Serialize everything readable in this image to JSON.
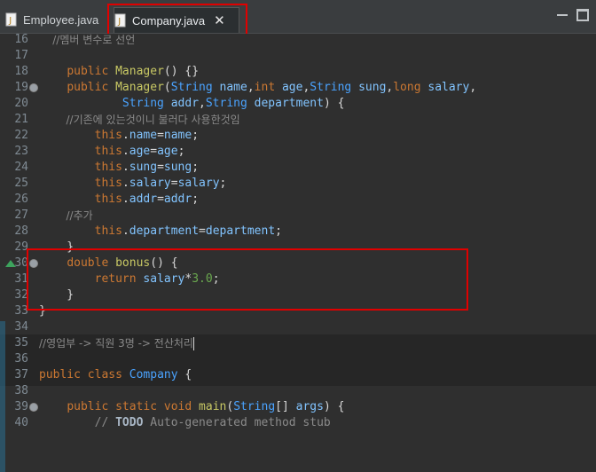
{
  "tabs": [
    {
      "label": "Employee.java",
      "active": false
    },
    {
      "label": "Company.java",
      "active": true
    }
  ],
  "lines": [
    {
      "n": "16",
      "html": "<span class='cmt'>    //멤버 변수로 선언</span>"
    },
    {
      "n": "17",
      "html": ""
    },
    {
      "n": "18",
      "html": "    <span class='k'>public</span> <span class='fn'>Manager</span>() {}"
    },
    {
      "n": "19",
      "html": "    <span class='k'>public</span> <span class='fn'>Manager</span>(<span class='cls'>String</span> <span class='v'>name</span>,<span class='k'>int</span> <span class='v'>age</span>,<span class='cls'>String</span> <span class='v'>sung</span>,<span class='k'>long</span> <span class='v'>salary</span>,"
    },
    {
      "n": "20",
      "html": "            <span class='cls'>String</span> <span class='v'>addr</span>,<span class='cls'>String</span> <span class='v'>department</span>) {"
    },
    {
      "n": "21",
      "html": "<span class='cmt'>        //기존에 있는것이니 불러다 사용한것임</span>"
    },
    {
      "n": "22",
      "html": "        <span class='k'>this</span>.<span class='v'>name</span>=<span class='v'>name</span>;"
    },
    {
      "n": "23",
      "html": "        <span class='k'>this</span>.<span class='v'>age</span>=<span class='v'>age</span>;"
    },
    {
      "n": "24",
      "html": "        <span class='k'>this</span>.<span class='v'>sung</span>=<span class='v'>sung</span>;"
    },
    {
      "n": "25",
      "html": "        <span class='k'>this</span>.<span class='v'>salary</span>=<span class='v'>salary</span>;"
    },
    {
      "n": "26",
      "html": "        <span class='k'>this</span>.<span class='v'>addr</span>=<span class='v'>addr</span>;"
    },
    {
      "n": "27",
      "html": "<span class='cmt'>        //추가</span>"
    },
    {
      "n": "28",
      "html": "        <span class='k'>this</span>.<span class='v'>department</span>=<span class='v'>department</span>;"
    },
    {
      "n": "29",
      "html": "    }"
    },
    {
      "n": "30",
      "html": "    <span class='k'>double</span> <span class='fn'>bonus</span>() {"
    },
    {
      "n": "31",
      "html": "        <span class='k'>return</span> <span class='v'>salary</span>*<span class='num'>3.0</span>;"
    },
    {
      "n": "32",
      "html": "    }"
    },
    {
      "n": "33",
      "html": "}"
    },
    {
      "n": "34",
      "html": ""
    },
    {
      "n": "35",
      "html": "<span class='cmt'>//영업부 -&gt; 직원 3명 -&gt; 전산처리</span><span class='cursor'></span>"
    },
    {
      "n": "36",
      "html": ""
    },
    {
      "n": "37",
      "html": "<span class='k'>public</span> <span class='k'>class</span> <span class='cls'>Company</span> {"
    },
    {
      "n": "38",
      "html": ""
    },
    {
      "n": "39",
      "html": "    <span class='k'>public</span> <span class='k'>static</span> <span class='k'>void</span> <span class='fn'>main</span>(<span class='cls'>String</span>[] <span class='v'>args</span>) {"
    },
    {
      "n": "40",
      "html": "        <span class='todotext'>// </span><span class='todo'>TODO</span><span class='todotext'> Auto-generated method stub</span>"
    }
  ]
}
